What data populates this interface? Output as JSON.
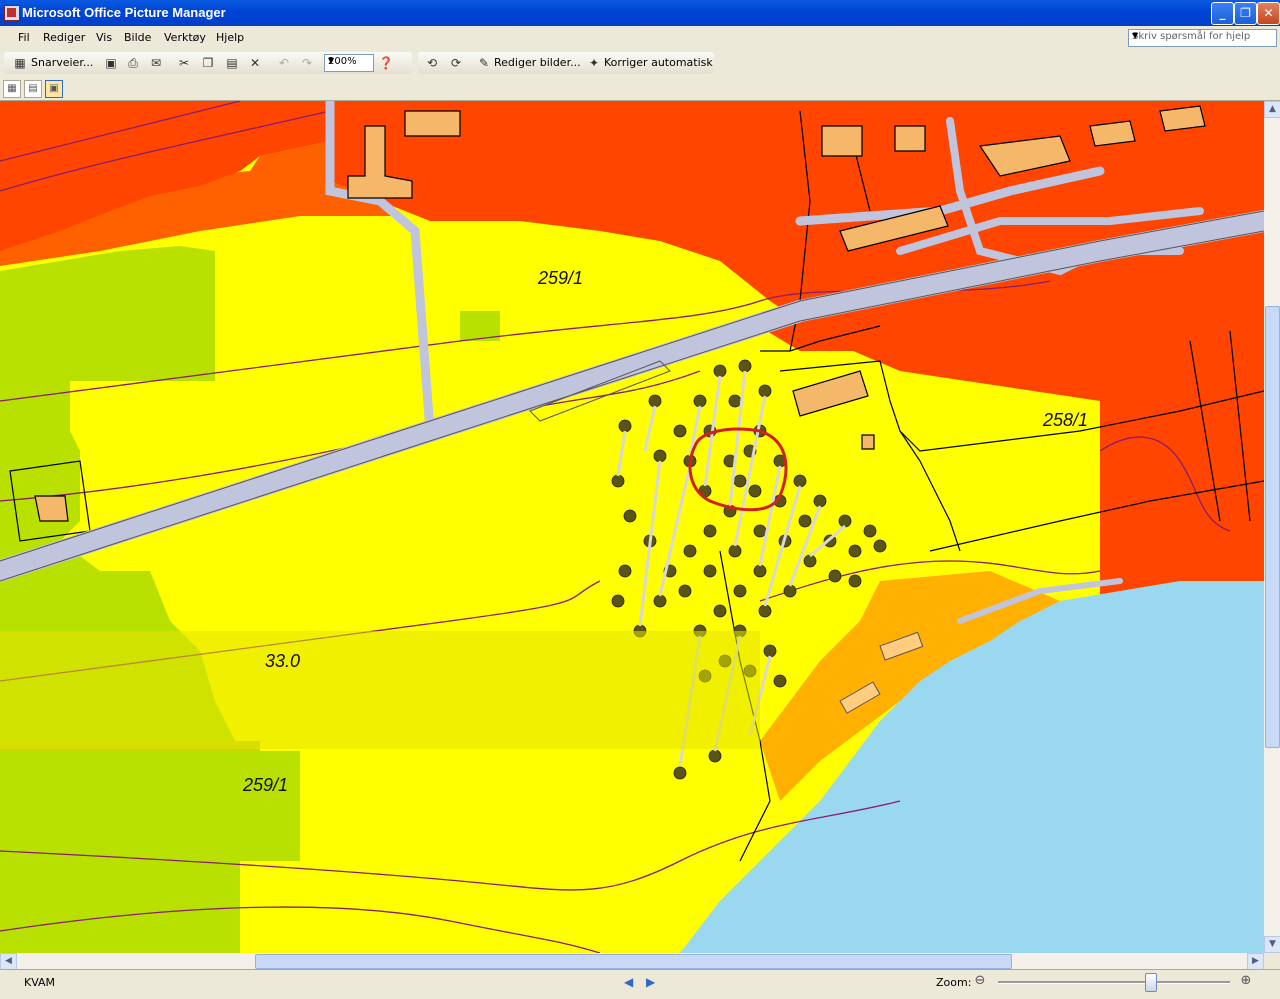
{
  "window": {
    "title": "Microsoft Office Picture Manager"
  },
  "menu": [
    "Fil",
    "Rediger",
    "Vis",
    "Bilde",
    "Verktøy",
    "Hjelp"
  ],
  "help_box": {
    "placeholder": "Skriv spørsmål for hjelp"
  },
  "toolbar": {
    "shortcuts_label": "Snarveier...",
    "zoom_value": "200%",
    "edit_pictures_label": "Rediger bilder...",
    "auto_correct_label": "Korriger automatisk"
  },
  "map": {
    "elevation_labels": [
      "259/1",
      "258/1",
      "33.0",
      "259/1"
    ]
  },
  "status": {
    "text": "KVAM",
    "zoom_label": "Zoom:"
  },
  "colors": {
    "titlebar": "#0a5ae0",
    "map_red": "#ff4500",
    "map_yellow": "#ffff00",
    "map_green": "#b8e000",
    "water": "#9ad8ef",
    "road": "#c0c4dc"
  }
}
